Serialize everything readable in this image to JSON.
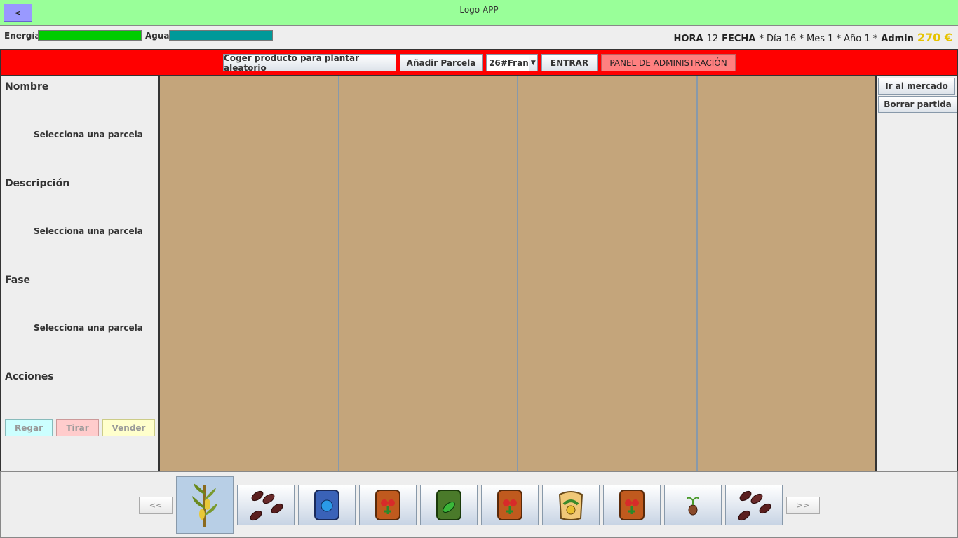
{
  "titlebar": {
    "back_label": "<",
    "title": "Logo APP"
  },
  "status": {
    "energy_label": "Energía",
    "energy_level": 1.0,
    "water_label": "Agua",
    "water_level": 1.0,
    "hora_label": "HORA",
    "hora_value": "12",
    "fecha_label": "FECHA",
    "fecha_value": "* Día 16 * Mes 1 * Año 1 *",
    "user": "Admin",
    "money": "270 €"
  },
  "toolbar": {
    "random_plant": "Coger producto para plantar aleatorio",
    "add_plot": "Añadir Parcela",
    "game_select": "26#Fran",
    "enter": "ENTRAR",
    "admin_panel": "PANEL DE ADMINISTRACIÓN"
  },
  "details": {
    "name_label": "Nombre",
    "name_value": "Selecciona una parcela",
    "desc_label": "Descripción",
    "desc_value": "Selecciona una parcela",
    "phase_label": "Fase",
    "phase_value": "Selecciona una parcela",
    "actions_label": "Acciones",
    "water_btn": "Regar",
    "throw_btn": "Tirar",
    "sell_btn": "Vender"
  },
  "right": {
    "market": "Ir al mercado",
    "delete": "Borrar partida"
  },
  "inventory": {
    "prev": "<<",
    "next": ">>",
    "items": [
      "corn-plant-icon",
      "coffee-beans-icon",
      "blue-seed-packet-icon",
      "red-flower-seed-packet-icon",
      "green-seed-packet-icon",
      "red-flower-seed-packet-icon",
      "yellow-seed-packet-icon",
      "red-flower-seed-packet-icon",
      "sprout-icon",
      "coffee-beans-icon"
    ]
  },
  "colors": {
    "title_bg": "#99ff99",
    "toolbar_bg": "#ff0000",
    "field": "#c4a57b",
    "money": "#e6c300"
  }
}
